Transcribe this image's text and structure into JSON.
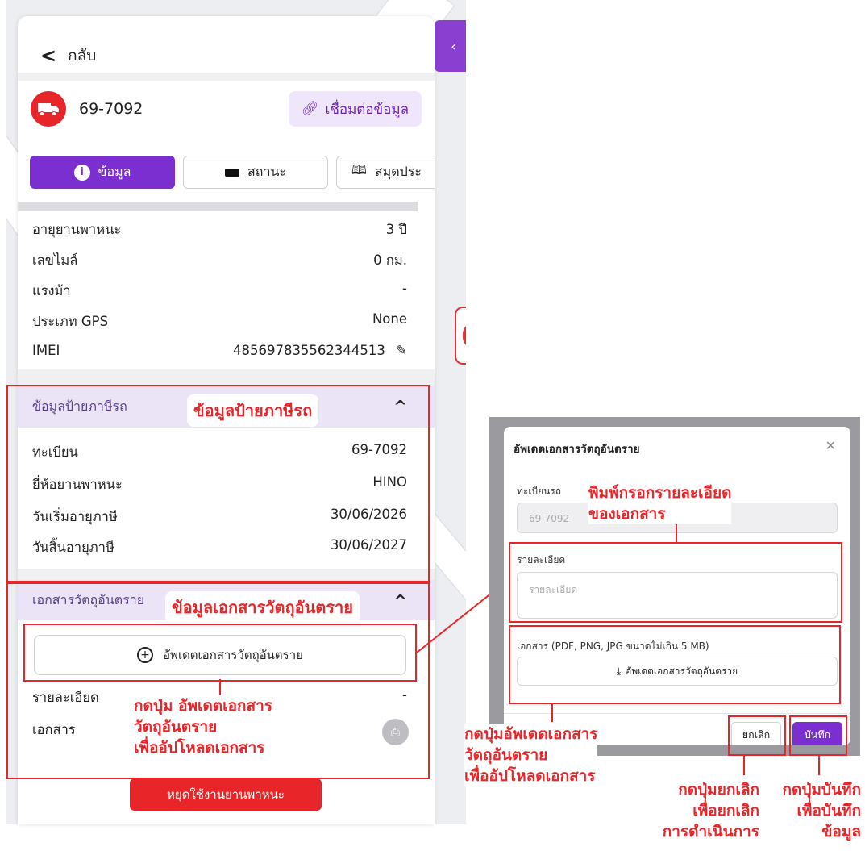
{
  "panel": {
    "back_label": "กลับ",
    "plate": "69-7092",
    "link_button": "เชื่อมต่อข้อมูล",
    "tabs": [
      {
        "label": "ข้อมูล",
        "icon": "info-icon"
      },
      {
        "label": "สถานะ",
        "icon": "battery-icon"
      },
      {
        "label": "สมุดประ",
        "icon": "book-icon"
      }
    ],
    "general": [
      {
        "label": "อายุยานพาหนะ",
        "value": "3 ปี"
      },
      {
        "label": "เลขไมล์",
        "value": "0 กม."
      },
      {
        "label": "แรงม้า",
        "value": "-"
      },
      {
        "label": "ประเภท GPS",
        "value": "None"
      },
      {
        "label": "IMEI",
        "value": "485697835562344513"
      }
    ],
    "tax_section": {
      "title": "ข้อมูลป้ายภาษีรถ",
      "rows": [
        {
          "label": "ทะเบียน",
          "value": "69-7092"
        },
        {
          "label": "ยี่ห้อยานพาหนะ",
          "value": "HINO"
        },
        {
          "label": "วันเริ่มอายุภาษี",
          "value": "30/06/2026"
        },
        {
          "label": "วันสิ้นอายุภาษี",
          "value": "30/06/2027"
        }
      ]
    },
    "hazard_section": {
      "title": "เอกสารวัตถุอันตราย",
      "upload_button": "อัพเดตเอกสารวัตถุอันตราย",
      "rows": [
        {
          "label": "รายละเอียด",
          "value": "-"
        },
        {
          "label": "เอกสาร",
          "value": ""
        }
      ]
    },
    "stop_button": "หยุดใช้งานยานพาหนะ"
  },
  "modal": {
    "title": "อัพเดตเอกสารวัตถุอันตราย",
    "plate_label": "ทะเบียนรถ",
    "plate_value": "69-7092",
    "detail_label": "รายละเอียด",
    "detail_placeholder": "รายละเอียด",
    "doc_label": "เอกสาร (PDF, PNG, JPG ขนาดไม่เกิน 5 MB)",
    "upload_button": "อัพเดตเอกสารวัตถุอันตราย",
    "cancel_button": "ยกเลิก",
    "save_button": "บันทึก"
  },
  "annotations": {
    "tax_info": "ข้อมูลป้ายภาษีรถ",
    "hazard_info": "ข้อมูลเอกสารวัตถุอันตราย",
    "press_upload_left": [
      "กดปุ่ม อัพเดตเอกสาร",
      "วัตถุอันตราย",
      "เพื่ออัปโหลดเอกสาร"
    ],
    "type_details": [
      "พิมพ์กรอกรายละเอียด",
      "ของเอกสาร"
    ],
    "press_upload_right": [
      "กดปุ่มอัพเดตเอกสาร",
      "วัตถุอันตราย",
      "เพื่ออัปโหลดเอกสาร"
    ],
    "press_cancel": [
      "กดปุ่มยกเลิก",
      "เพื่อยกเลิก",
      "การดำเนินการ"
    ],
    "press_save": [
      "กดปุ่มบันทึก",
      "เพื่อบันทึก",
      "ข้อมูล"
    ]
  },
  "colors": {
    "accent": "#7b2fd0",
    "danger": "#e8262a",
    "section_bg": "#ebe4f7"
  }
}
